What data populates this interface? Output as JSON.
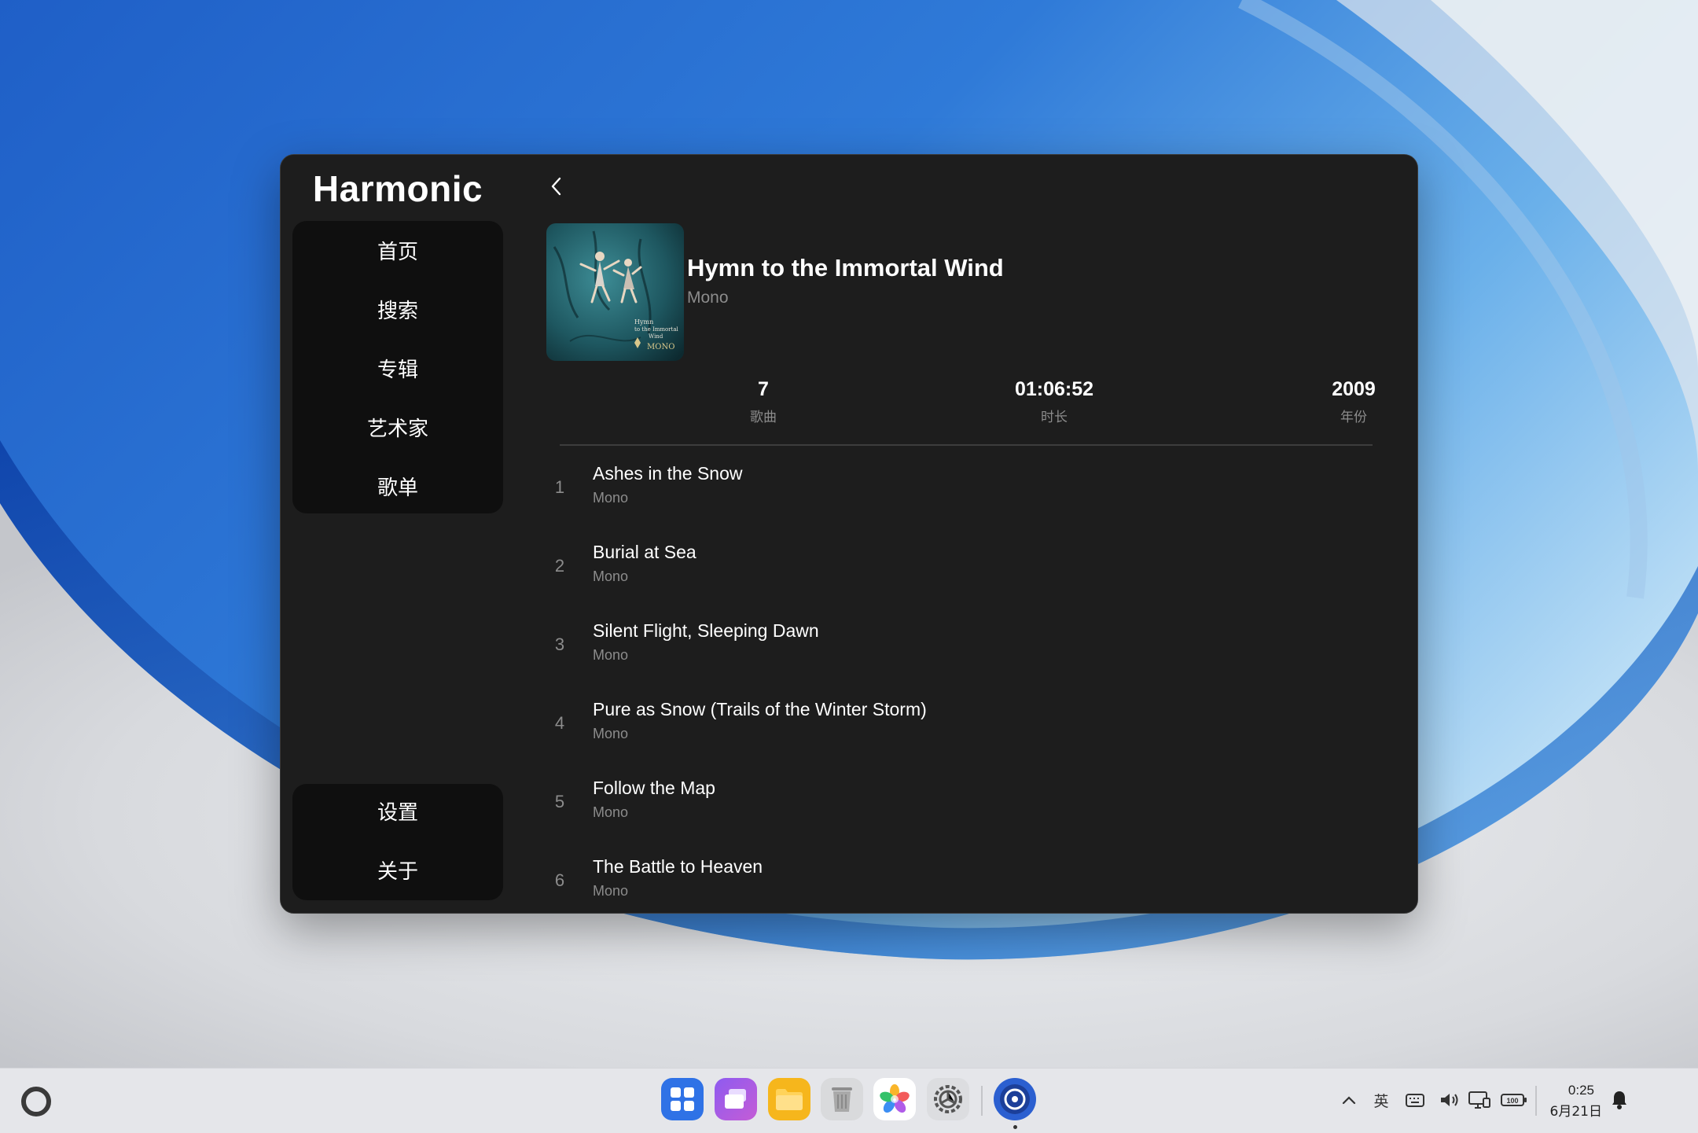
{
  "app": {
    "title": "Harmonic",
    "nav_main": [
      "首页",
      "搜索",
      "专辑",
      "艺术家",
      "歌单"
    ],
    "nav_bottom": [
      "设置",
      "关于"
    ]
  },
  "album": {
    "title": "Hymn to the Immortal Wind",
    "artist": "Mono",
    "cover_text": [
      "Hymn",
      "to the Immortal",
      "Wind",
      "MONO"
    ],
    "stats": {
      "songs_value": "7",
      "songs_label": "歌曲",
      "duration_value": "01:06:52",
      "duration_label": "时长",
      "year_value": "2009",
      "year_label": "年份"
    }
  },
  "tracks": [
    {
      "num": "1",
      "title": "Ashes in the Snow",
      "artist": "Mono"
    },
    {
      "num": "2",
      "title": "Burial at Sea",
      "artist": "Mono"
    },
    {
      "num": "3",
      "title": "Silent Flight, Sleeping Dawn",
      "artist": "Mono"
    },
    {
      "num": "4",
      "title": "Pure as Snow (Trails of the Winter Storm)",
      "artist": "Mono"
    },
    {
      "num": "5",
      "title": "Follow the Map",
      "artist": "Mono"
    },
    {
      "num": "6",
      "title": "The Battle to Heaven",
      "artist": "Mono"
    }
  ],
  "window_controls": [
    "back-icon",
    "restore-icon",
    "minimize-icon",
    "close-icon"
  ],
  "taskbar": {
    "dock": [
      "launcher-icon",
      "multitask-icon",
      "files-icon",
      "trash-icon",
      "gallery-icon",
      "settings-icon",
      "music-player-icon"
    ],
    "tray": {
      "ime": "英",
      "battery": "100"
    },
    "time": "0:25",
    "date": "6月21日"
  },
  "colors": {
    "window_bg": "#1d1d1d",
    "nav_card_bg": "#0f0f0f",
    "secondary_text": "#8c8c8c",
    "accent_blue": "#2f72e6"
  }
}
